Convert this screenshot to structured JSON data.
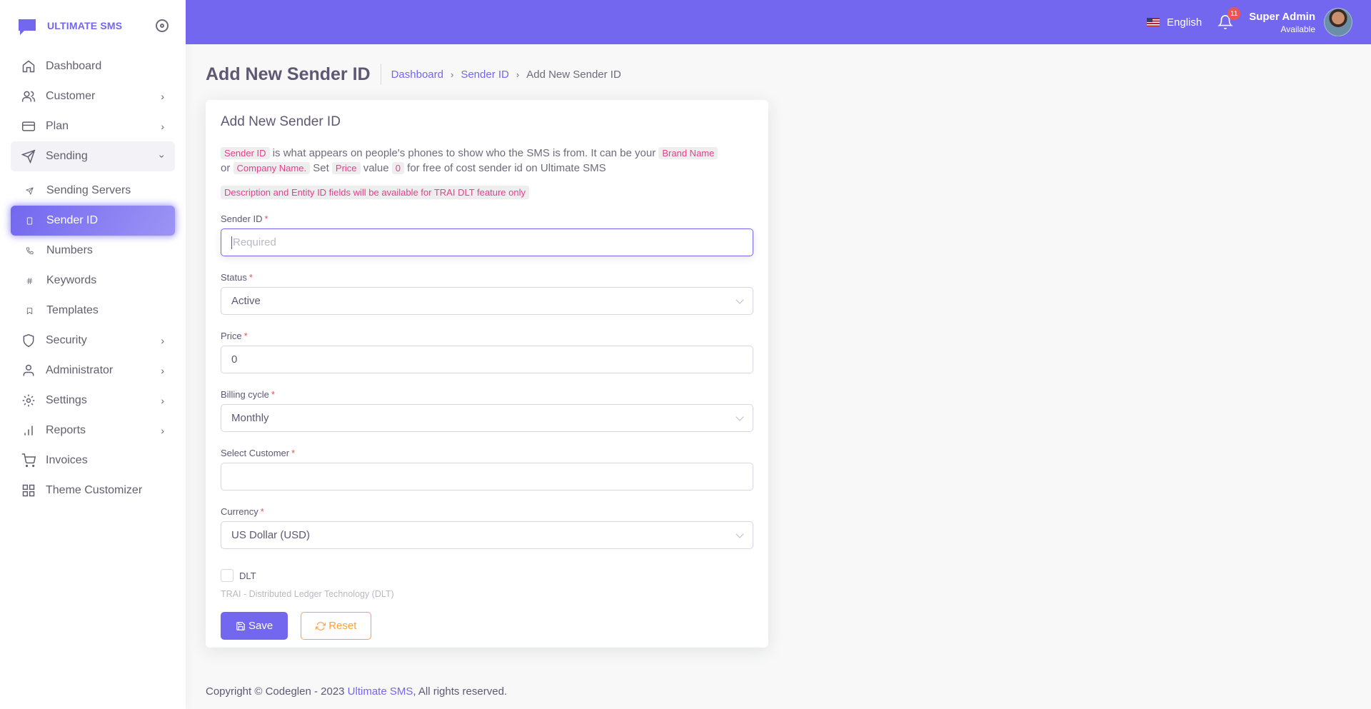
{
  "brand": {
    "name": "ULTIMATE SMS"
  },
  "sidebar": {
    "items": [
      {
        "label": "Dashboard",
        "icon": "home-icon"
      },
      {
        "label": "Customer",
        "icon": "users-icon"
      },
      {
        "label": "Plan",
        "icon": "credit-card-icon"
      },
      {
        "label": "Sending",
        "icon": "send-icon"
      },
      {
        "label": "Sending Servers",
        "icon": "send-icon"
      },
      {
        "label": "Sender ID",
        "icon": "tablet-icon"
      },
      {
        "label": "Numbers",
        "icon": "phone-icon"
      },
      {
        "label": "Keywords",
        "icon": "hash-icon"
      },
      {
        "label": "Templates",
        "icon": "bookmark-icon"
      },
      {
        "label": "Security",
        "icon": "shield-icon"
      },
      {
        "label": "Administrator",
        "icon": "user-icon"
      },
      {
        "label": "Settings",
        "icon": "gear-icon"
      },
      {
        "label": "Reports",
        "icon": "bar-chart-icon"
      },
      {
        "label": "Invoices",
        "icon": "shopping-cart-icon"
      },
      {
        "label": "Theme Customizer",
        "icon": "grid-icon"
      }
    ]
  },
  "navbar": {
    "language": "English",
    "notification_count": "11",
    "user_name": "Super Admin",
    "user_status": "Available"
  },
  "page": {
    "title": "Add New Sender ID",
    "breadcrumb": [
      "Dashboard",
      "Sender ID",
      "Add New Sender ID"
    ]
  },
  "card": {
    "title": "Add New Sender ID",
    "intro": {
      "tag_sender_id": "Sender ID",
      "text1": " is what appears on people's phones to show who the SMS is from. It can be your ",
      "tag_brand": "Brand Name",
      "text2": "or ",
      "tag_company": "Company Name.",
      "text3": " Set ",
      "tag_price": "Price",
      "text4": " value ",
      "tag_zero": "0",
      "text5": " for free of cost sender id on Ultimate SMS"
    },
    "notice": "Description and Entity ID fields will be available for TRAI DLT feature only"
  },
  "form": {
    "sender_id": {
      "label": "Sender ID",
      "placeholder": "Required",
      "value": ""
    },
    "status": {
      "label": "Status",
      "value": "Active"
    },
    "price": {
      "label": "Price",
      "value": "0"
    },
    "billing_cycle": {
      "label": "Billing cycle",
      "value": "Monthly"
    },
    "customer": {
      "label": "Select Customer",
      "value": ""
    },
    "currency": {
      "label": "Currency",
      "value": "US Dollar (USD)"
    },
    "dlt": {
      "label": "DLT",
      "checked": false,
      "help": "TRAI - Distributed Ledger Technology (DLT)"
    },
    "required_mark": "*",
    "save_label": "Save",
    "reset_label": "Reset"
  },
  "footer": {
    "prefix": "Copyright © Codeglen - 2023 ",
    "link": "Ultimate SMS",
    "suffix": ", All rights reserved."
  },
  "colors": {
    "primary": "#7367f0",
    "danger": "#ea5455",
    "warning": "#ff9f43",
    "code": "#e83e8c"
  }
}
